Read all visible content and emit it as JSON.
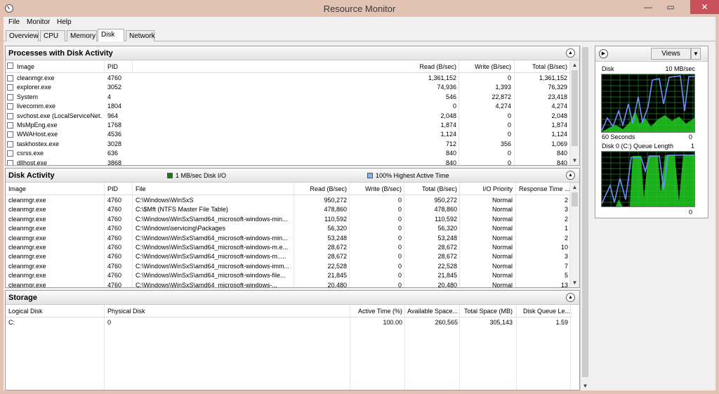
{
  "window": {
    "title": "Resource Monitor",
    "min": "—",
    "max": "▭",
    "close": "✕"
  },
  "menu": [
    "File",
    "Monitor",
    "Help"
  ],
  "tabs": [
    "Overview",
    "CPU",
    "Memory",
    "Disk",
    "Network"
  ],
  "active_tab": "Disk",
  "processes": {
    "title": "Processes with Disk Activity",
    "columns": {
      "image": "Image",
      "pid": "PID",
      "read": "Read (B/sec)",
      "write": "Write (B/sec)",
      "total": "Total (B/sec)"
    },
    "rows": [
      [
        "cleanmgr.exe",
        "4760",
        "1,361,152",
        "0",
        "1,361,152"
      ],
      [
        "explorer.exe",
        "3052",
        "74,936",
        "1,393",
        "76,329"
      ],
      [
        "System",
        "4",
        "546",
        "22,872",
        "23,418"
      ],
      [
        "livecomm.exe",
        "1804",
        "0",
        "4,274",
        "4,274"
      ],
      [
        "svchost.exe (LocalServiceNet...",
        "964",
        "2,048",
        "0",
        "2,048"
      ],
      [
        "MsMpEng.exe",
        "1768",
        "1,874",
        "0",
        "1,874"
      ],
      [
        "WWAHost.exe",
        "4536",
        "1,124",
        "0",
        "1,124"
      ],
      [
        "taskhostex.exe",
        "3028",
        "712",
        "356",
        "1,069"
      ],
      [
        "csrss.exe",
        "636",
        "840",
        "0",
        "840"
      ],
      [
        "dllhost.exe",
        "3868",
        "840",
        "0",
        "840"
      ]
    ]
  },
  "disk_activity": {
    "title": "Disk Activity",
    "legend_io": "1 MB/sec Disk I/O",
    "legend_active": "100% Highest Active Time",
    "legend_io_color": "#1a7a1a",
    "legend_active_color": "#7ab8f0",
    "columns": {
      "image": "Image",
      "pid": "PID",
      "file": "File",
      "read": "Read (B/sec)",
      "write": "Write (B/sec)",
      "total": "Total (B/sec)",
      "priority": "I/O Priority",
      "response": "Response Time ..."
    },
    "rows": [
      [
        "cleanmgr.exe",
        "4760",
        "C:\\Windows\\WinSxS",
        "950,272",
        "0",
        "950,272",
        "Normal",
        "2"
      ],
      [
        "cleanmgr.exe",
        "4760",
        "C:\\$Mft (NTFS Master File Table)",
        "478,860",
        "0",
        "478,860",
        "Normal",
        "3"
      ],
      [
        "cleanmgr.exe",
        "4760",
        "C:\\Windows\\WinSxS\\amd64_microsoft-windows-min...",
        "110,592",
        "0",
        "110,592",
        "Normal",
        "2"
      ],
      [
        "cleanmgr.exe",
        "4760",
        "C:\\Windows\\servicing\\Packages",
        "56,320",
        "0",
        "56,320",
        "Normal",
        "1"
      ],
      [
        "cleanmgr.exe",
        "4760",
        "C:\\Windows\\WinSxS\\amd64_microsoft-windows-min...",
        "53,248",
        "0",
        "53,248",
        "Normal",
        "2"
      ],
      [
        "cleanmgr.exe",
        "4760",
        "C:\\Windows\\WinSxS\\amd64_microsoft-windows-m.e...",
        "28,672",
        "0",
        "28,672",
        "Normal",
        "10"
      ],
      [
        "cleanmgr.exe",
        "4760",
        "C:\\Windows\\WinSxS\\amd64_microsoft-windows-m.....",
        "28,672",
        "0",
        "28,672",
        "Normal",
        "3"
      ],
      [
        "cleanmgr.exe",
        "4760",
        "C:\\Windows\\WinSxS\\amd64_microsoft-windows-imm...",
        "22,528",
        "0",
        "22,528",
        "Normal",
        "7"
      ],
      [
        "cleanmgr.exe",
        "4760",
        "C:\\Windows\\WinSxS\\amd64_microsoft-windows-file...",
        "21,845",
        "0",
        "21,845",
        "Normal",
        "5"
      ],
      [
        "cleanmgr.exe",
        "4760",
        "C:\\Windows\\WinSxS\\amd64_microsoft-windows-...",
        "20,480",
        "0",
        "20,480",
        "Normal",
        "13"
      ]
    ]
  },
  "storage": {
    "title": "Storage",
    "columns": {
      "logical": "Logical Disk",
      "physical": "Physical Disk",
      "active": "Active Time (%)",
      "available": "Available Space...",
      "total": "Total Space (MB)",
      "queue": "Disk Queue Le..."
    },
    "rows": [
      [
        "C:",
        "0",
        "100.00",
        "260,565",
        "305,143",
        "1.59"
      ]
    ]
  },
  "side": {
    "views": "Views",
    "disk_label": "Disk",
    "disk_max": "10 MB/sec",
    "seconds": "60 Seconds",
    "disk_min": "0",
    "queue_label": "Disk 0 (C:) Queue Length",
    "queue_max": "1",
    "queue_min": "0",
    "grid_color": "#1f8a1f",
    "io_color": "#22cc22",
    "active_color": "#6f8fff"
  },
  "scroll": {
    "up": "▲",
    "down": "▼"
  },
  "collapse_glyph": "▲",
  "nav_glyph": "▶",
  "drop_glyph": "▼"
}
